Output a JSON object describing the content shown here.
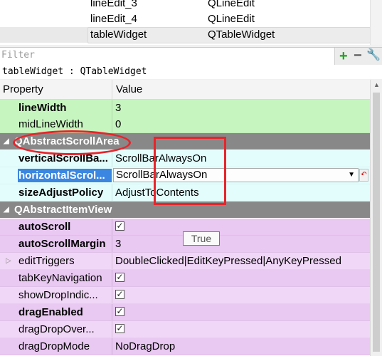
{
  "object_list": [
    {
      "name": "lineEdit_3",
      "class": "QLineEdit"
    },
    {
      "name": "lineEdit_4",
      "class": "QLineEdit"
    },
    {
      "name": "tableWidget",
      "class": "QTableWidget"
    }
  ],
  "filter": {
    "placeholder": "Filter",
    "add_icon": "plus-icon",
    "remove_icon": "minus-icon",
    "config_icon": "wrench-icon"
  },
  "current_object": "tableWidget : QTableWidget",
  "table": {
    "header": {
      "property": "Property",
      "value": "Value"
    },
    "rows": {
      "lineWidth": {
        "name": "lineWidth",
        "value": "3"
      },
      "midLineWidth": {
        "name": "midLineWidth",
        "value": "0"
      },
      "group_scrollarea": "QAbstractScrollArea",
      "verticalScroll": {
        "name": "verticalScrollBa...",
        "value": "ScrollBarAlwaysOn"
      },
      "horizontalScroll": {
        "name": "horizontalScrol...",
        "value": "ScrollBarAlwaysOn"
      },
      "sizeAdjust": {
        "name": "sizeAdjustPolicy",
        "value": "AdjustToContents"
      },
      "group_itemview": "QAbstractItemView",
      "autoScroll": {
        "name": "autoScroll",
        "checked": true
      },
      "autoScrollMargin": {
        "name": "autoScrollMargin",
        "value": "3"
      },
      "editTriggers": {
        "name": "editTriggers",
        "value": "DoubleClicked|EditKeyPressed|AnyKeyPressed"
      },
      "tabKeyNavigation": {
        "name": "tabKeyNavigation",
        "checked": true
      },
      "showDropIndicator": {
        "name": "showDropIndic...",
        "checked": true
      },
      "dragEnabled": {
        "name": "dragEnabled",
        "checked": true
      },
      "dragDropOverwrite": {
        "name": "dragDropOver...",
        "checked": true
      },
      "dragDropMode": {
        "name": "dragDropMode",
        "value": "NoDragDrop"
      }
    }
  },
  "tooltip": "True",
  "colors": {
    "annotation": "#e8242b",
    "selection": "#3b86e0",
    "green_row": "#c7f5c0",
    "purple_row": "#e9c8f2"
  }
}
